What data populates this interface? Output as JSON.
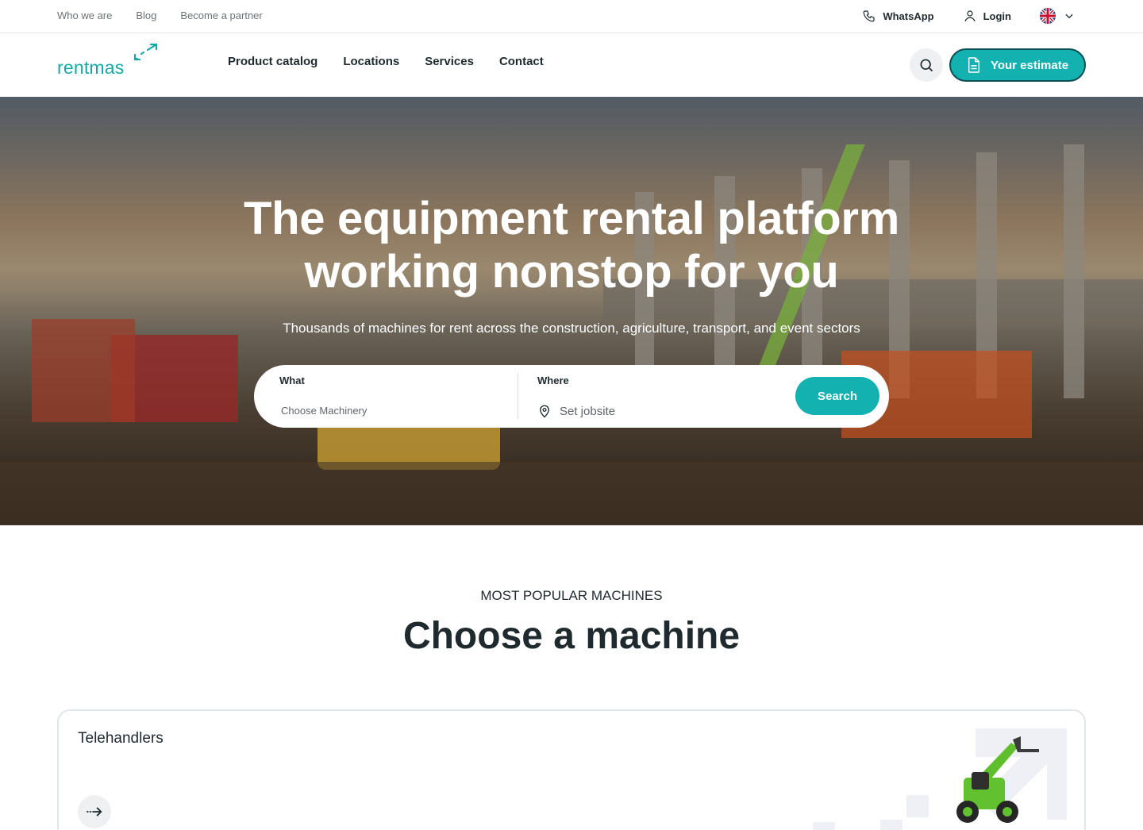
{
  "topbar": {
    "links": [
      "Who we are",
      "Blog",
      "Become a partner"
    ],
    "whatsapp_label": "WhatsApp",
    "login_label": "Login",
    "language_icon": "uk-flag-icon"
  },
  "header": {
    "logo_text": "rentmas",
    "nav": [
      "Product catalog",
      "Locations",
      "Services",
      "Contact"
    ],
    "estimate_label": "Your estimate"
  },
  "hero": {
    "title_line1": "The equipment rental platform",
    "title_line2": "working nonstop for you",
    "subtitle": "Thousands of machines for rent across the construction, agriculture, transport, and event sectors",
    "search": {
      "what_label": "What",
      "what_placeholder": "Choose Machinery",
      "where_label": "Where",
      "where_placeholder": "Set jobsite",
      "button_label": "Search"
    }
  },
  "section": {
    "eyebrow": "MOST POPULAR MACHINES",
    "title": "Choose a machine"
  },
  "cards": [
    {
      "title": "Telehandlers"
    }
  ],
  "colors": {
    "accent": "#13b2b0",
    "accent_border": "#0c4f52",
    "text": "#1f2a2e",
    "muted": "#6b7276"
  }
}
